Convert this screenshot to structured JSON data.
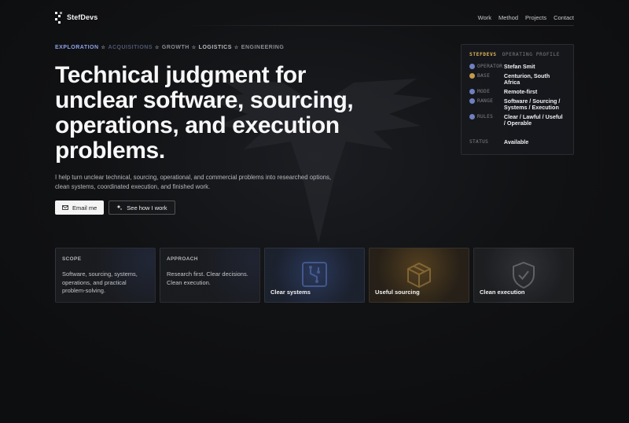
{
  "brand": {
    "name": "StefDevs"
  },
  "nav": {
    "links": [
      "Work",
      "Method",
      "Projects",
      "Contact"
    ]
  },
  "tags": [
    {
      "label": "EXPLORATION",
      "color": "#8fa2e8"
    },
    {
      "label": "ACQUISITIONS",
      "color": "#4f5770"
    },
    {
      "label": "GROWTH",
      "color": "#8b8d92"
    },
    {
      "label": "LOGISTICS",
      "color": "#b9bbbf"
    },
    {
      "label": "ENGINEERING",
      "color": "#8b8d92"
    }
  ],
  "hero": {
    "title": "Technical judgment for unclear software, sourcing, operations, and execution problems.",
    "subtitle": "I help turn unclear technical, sourcing, operational, and commercial problems into researched options, clean systems, coordinated execution, and finished work.",
    "cta_primary": "Email me",
    "cta_secondary": "See how I work"
  },
  "profile": {
    "brand": "STEFDEVS",
    "kind": "OPERATING PROFILE",
    "rows": [
      {
        "key": "OPERATOR",
        "value": "Stefan Smit",
        "icon": "user-icon",
        "color": "#6f7fc0"
      },
      {
        "key": "BASE",
        "value": "Centurion, South Africa",
        "icon": "location-icon",
        "color": "#c29a4a"
      },
      {
        "key": "MODE",
        "value": "Remote-first",
        "icon": "globe-icon",
        "color": "#6f7fc0"
      },
      {
        "key": "RANGE",
        "value": "Software / Sourcing / Systems / Execution",
        "icon": "share-icon",
        "color": "#6f7fc0"
      },
      {
        "key": "RULES",
        "value": "Clear / Lawful / Useful / Operable",
        "icon": "rules-icon",
        "color": "#6f7fc0"
      }
    ],
    "status_key": "STATUS",
    "status_value": "Available"
  },
  "cards": {
    "scope": {
      "label": "SCOPE",
      "body": "Software, sourcing, systems, operations, and practical problem-solving."
    },
    "approach": {
      "label": "APPROACH",
      "body": "Research first. Clear decisions. Clean execution."
    },
    "systems": {
      "caption": "Clear systems",
      "icon": "circuit-icon"
    },
    "sourcing": {
      "caption": "Useful sourcing",
      "icon": "box-icon"
    },
    "execution": {
      "caption": "Clean execution",
      "icon": "shield-check-icon"
    }
  }
}
